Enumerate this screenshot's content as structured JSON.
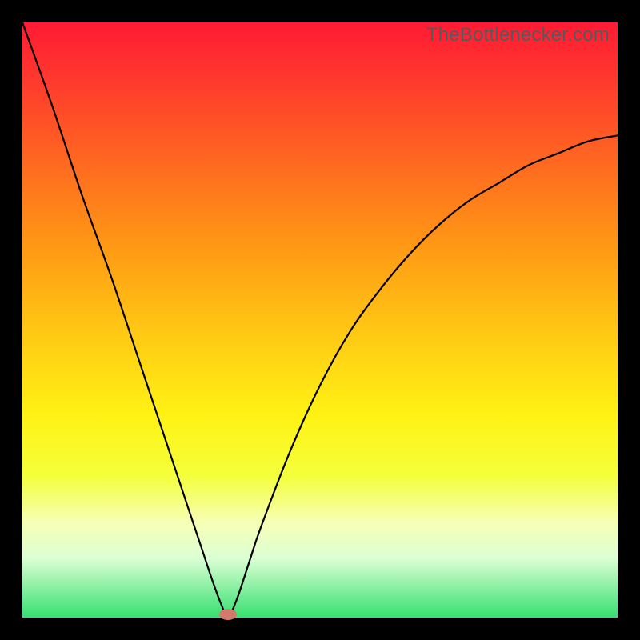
{
  "attribution": "TheBottlenecker.com",
  "chart_data": {
    "type": "line",
    "title": "",
    "xlabel": "",
    "ylabel": "",
    "xlim": [
      0,
      100
    ],
    "ylim": [
      0,
      100
    ],
    "series": [
      {
        "name": "bottleneck-curve",
        "x": [
          0,
          5,
          10,
          15,
          20,
          25,
          28,
          30,
          32,
          33.5,
          34.5,
          36,
          38,
          40,
          45,
          50,
          55,
          60,
          65,
          70,
          75,
          80,
          85,
          90,
          95,
          100
        ],
        "values": [
          100,
          86,
          71,
          57,
          42,
          27,
          18,
          12,
          6,
          2,
          0,
          3,
          9,
          15,
          28,
          39,
          48,
          55,
          61,
          66,
          70,
          73,
          76,
          78,
          80,
          81
        ]
      }
    ],
    "marker": {
      "x": 34.5,
      "y": 0,
      "color": "#d47a6a"
    },
    "background_gradient": {
      "stops": [
        {
          "pos": 0,
          "color": "#ff1a33"
        },
        {
          "pos": 24,
          "color": "#ff6a20"
        },
        {
          "pos": 52,
          "color": "#ffc814"
        },
        {
          "pos": 76,
          "color": "#f4ff3a"
        },
        {
          "pos": 90,
          "color": "#dcffd4"
        },
        {
          "pos": 100,
          "color": "#36e070"
        }
      ]
    }
  }
}
